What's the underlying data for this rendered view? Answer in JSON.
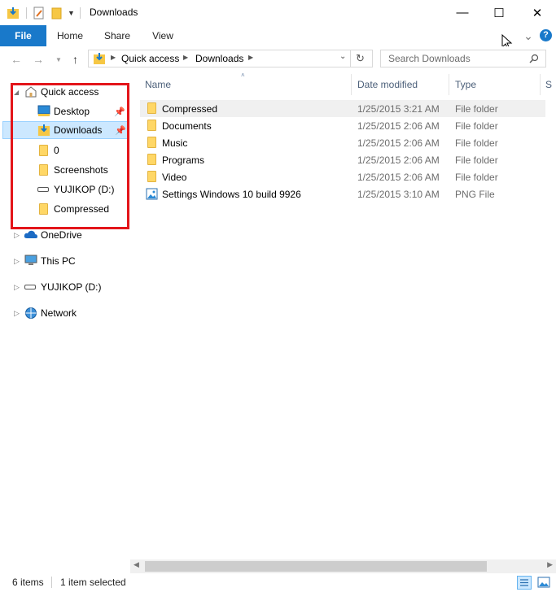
{
  "window": {
    "title": "Downloads",
    "minimize_glyph": "—",
    "maximize_glyph": "☐",
    "close_glyph": "✕"
  },
  "ribbon": {
    "tabs": [
      {
        "label": "File"
      },
      {
        "label": "Home"
      },
      {
        "label": "Share"
      },
      {
        "label": "View"
      }
    ],
    "expand_glyph": "⌄",
    "help_glyph": "?"
  },
  "address": {
    "segments": [
      "Quick access",
      "Downloads"
    ],
    "search_placeholder": "Search Downloads"
  },
  "nav": {
    "items": [
      {
        "label": "Quick access",
        "icon": "home-icon"
      },
      {
        "label": "Desktop",
        "icon": "desktop-icon",
        "pinned": true
      },
      {
        "label": "Downloads",
        "icon": "download-folder-icon",
        "pinned": true,
        "selected": true
      },
      {
        "label": "0",
        "icon": "folder-icon"
      },
      {
        "label": "Screenshots",
        "icon": "folder-icon"
      },
      {
        "label": "YUJIKOP (D:)",
        "icon": "drive-icon"
      },
      {
        "label": "Compressed",
        "icon": "folder-icon"
      },
      {
        "label": "OneDrive",
        "icon": "onedrive-icon"
      },
      {
        "label": "This PC",
        "icon": "pc-icon"
      },
      {
        "label": "YUJIKOP (D:)",
        "icon": "drive-icon"
      },
      {
        "label": "Network",
        "icon": "network-icon"
      }
    ]
  },
  "columns": {
    "name": "Name",
    "date": "Date modified",
    "type": "Type",
    "size": "S"
  },
  "files": [
    {
      "name": "Compressed",
      "date": "1/25/2015 3:21 AM",
      "type": "File folder",
      "icon": "folder-icon"
    },
    {
      "name": "Documents",
      "date": "1/25/2015 2:06 AM",
      "type": "File folder",
      "icon": "folder-icon"
    },
    {
      "name": "Music",
      "date": "1/25/2015 2:06 AM",
      "type": "File folder",
      "icon": "folder-icon"
    },
    {
      "name": "Programs",
      "date": "1/25/2015 2:06 AM",
      "type": "File folder",
      "icon": "folder-icon"
    },
    {
      "name": "Video",
      "date": "1/25/2015 2:06 AM",
      "type": "File folder",
      "icon": "folder-icon"
    },
    {
      "name": "Settings Windows 10 build 9926",
      "date": "1/25/2015 3:10 AM",
      "type": "PNG File",
      "icon": "image-file-icon"
    }
  ],
  "status": {
    "item_count": "6 items",
    "selection": "1 item selected"
  },
  "colors": {
    "accent": "#1979ca",
    "highlight_box": "#e3151a",
    "selected_bg": "#cce8ff"
  }
}
